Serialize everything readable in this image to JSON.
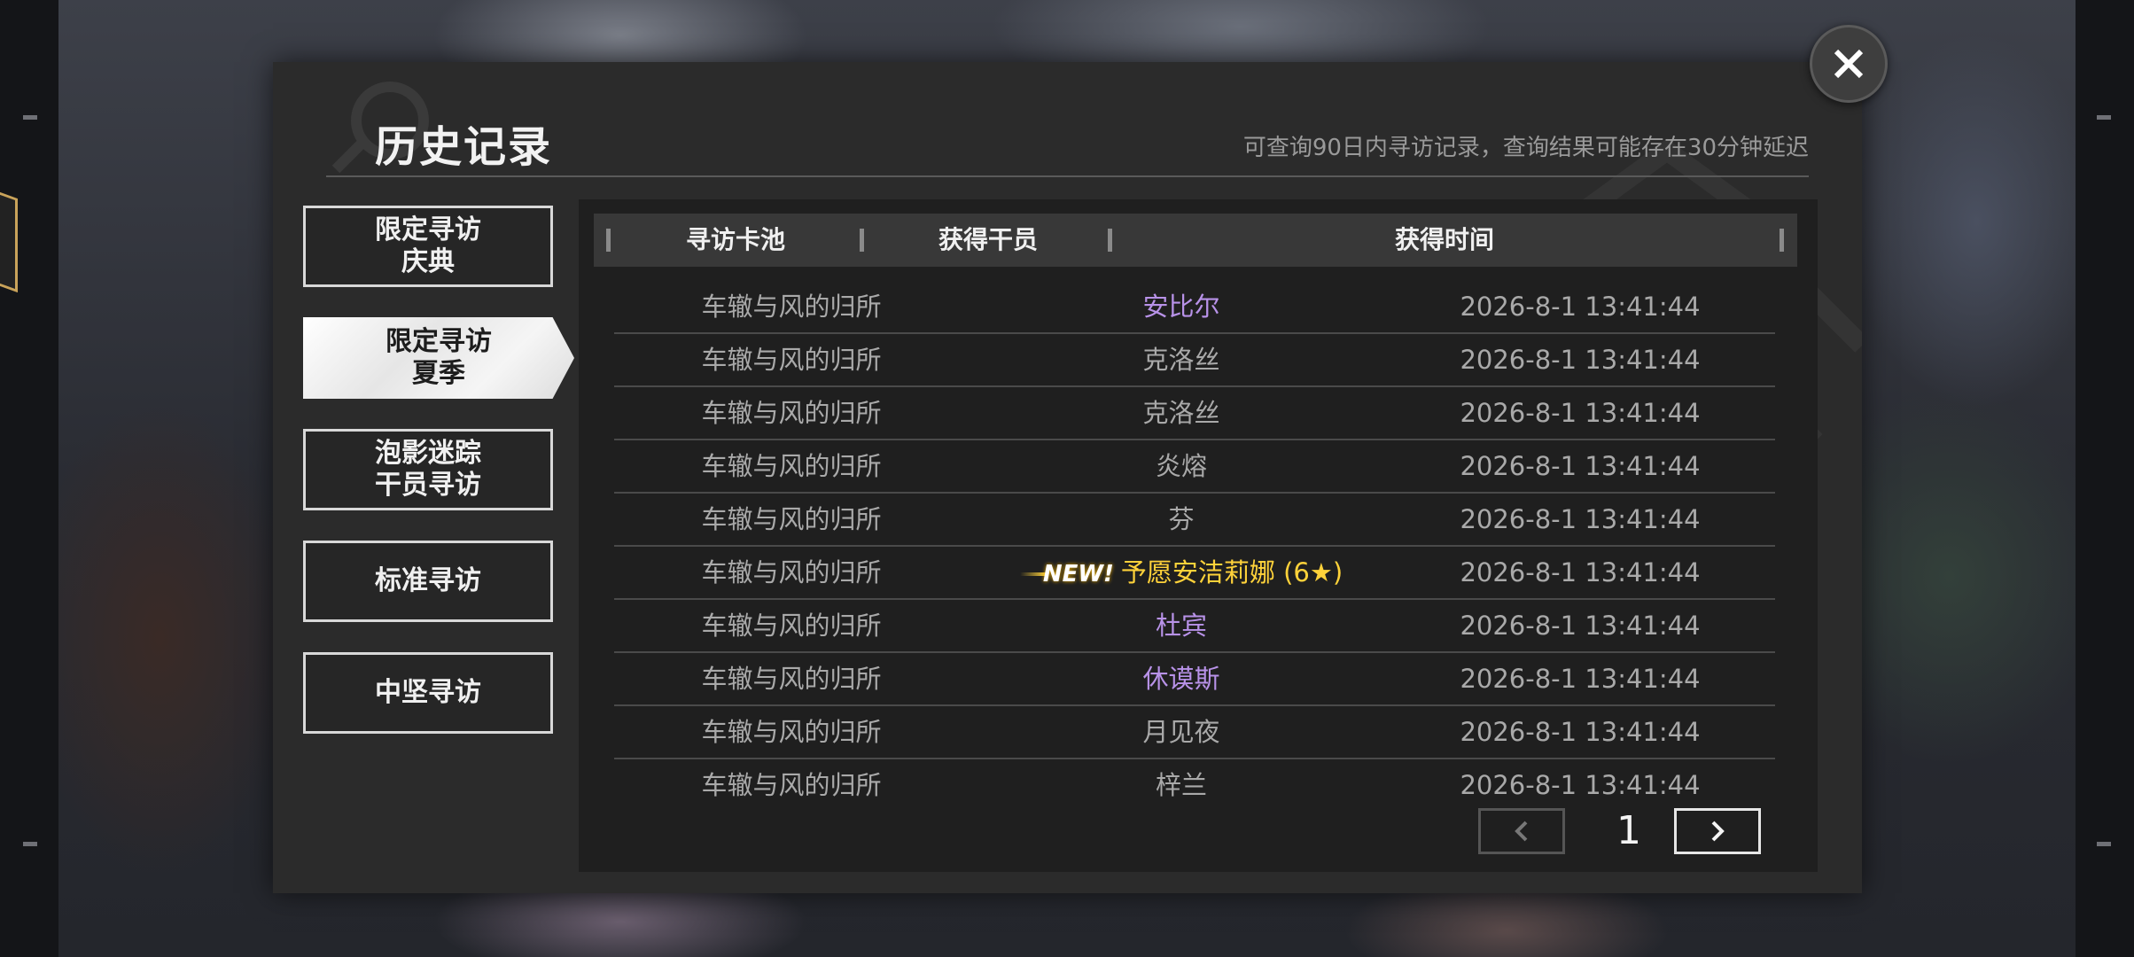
{
  "dialog": {
    "title": "历史记录",
    "hint": "可查询90日内寻访记录，查询结果可能存在30分钟延迟",
    "close_icon": "close-icon"
  },
  "tabs": [
    {
      "line1": "限定寻访",
      "line2": "庆典",
      "active": false
    },
    {
      "line1": "限定寻访",
      "line2": "夏季",
      "active": true
    },
    {
      "line1": "泡影迷踪",
      "line2": "干员寻访",
      "active": false
    },
    {
      "line1": "标准寻访",
      "line2": "",
      "active": false
    },
    {
      "line1": "中坚寻访",
      "line2": "",
      "active": false
    }
  ],
  "table": {
    "headers": [
      "寻访卡池",
      "获得干员",
      "获得时间"
    ],
    "rows": [
      {
        "pool": "车辙与风的归所",
        "operator": "安比尔",
        "time": "2026-8-1 13:41:44",
        "rarity": "purple",
        "new": false,
        "stars": ""
      },
      {
        "pool": "车辙与风的归所",
        "operator": "克洛丝",
        "time": "2026-8-1 13:41:44",
        "rarity": "normal",
        "new": false,
        "stars": ""
      },
      {
        "pool": "车辙与风的归所",
        "operator": "克洛丝",
        "time": "2026-8-1 13:41:44",
        "rarity": "normal",
        "new": false,
        "stars": ""
      },
      {
        "pool": "车辙与风的归所",
        "operator": "炎熔",
        "time": "2026-8-1 13:41:44",
        "rarity": "normal",
        "new": false,
        "stars": ""
      },
      {
        "pool": "车辙与风的归所",
        "operator": "芬",
        "time": "2026-8-1 13:41:44",
        "rarity": "normal",
        "new": false,
        "stars": ""
      },
      {
        "pool": "车辙与风的归所",
        "operator": "予愿安洁莉娜 (6★)",
        "time": "2026-8-1 13:41:44",
        "rarity": "gold",
        "new": true,
        "new_label": "NEW!"
      },
      {
        "pool": "车辙与风的归所",
        "operator": "杜宾",
        "time": "2026-8-1 13:41:44",
        "rarity": "purple",
        "new": false
      },
      {
        "pool": "车辙与风的归所",
        "operator": "休谟斯",
        "time": "2026-8-1 13:41:44",
        "rarity": "purple",
        "new": false
      },
      {
        "pool": "车辙与风的归所",
        "operator": "月见夜",
        "time": "2026-8-1 13:41:44",
        "rarity": "normal",
        "new": false
      },
      {
        "pool": "车辙与风的归所",
        "operator": "梓兰",
        "time": "2026-8-1 13:41:44",
        "rarity": "normal",
        "new": false
      }
    ]
  },
  "pager": {
    "current_page": "1",
    "prev_icon": "chevron-left-icon",
    "next_icon": "chevron-right-icon",
    "prev_enabled": false,
    "next_enabled": true
  },
  "colors": {
    "purple_operator": "#b892e8",
    "gold_operator": "#ffd23a",
    "normal_text": "#a9a9a9"
  }
}
